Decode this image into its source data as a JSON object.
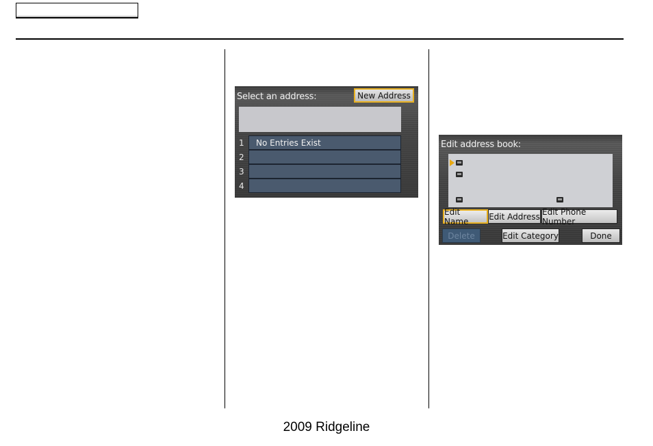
{
  "page": {
    "footer": "2009  Ridgeline"
  },
  "screen_select": {
    "title": "Select an address:",
    "new_button": "New Address",
    "rows": [
      {
        "num": "1",
        "label": "No Entries Exist"
      },
      {
        "num": "2",
        "label": ""
      },
      {
        "num": "3",
        "label": ""
      },
      {
        "num": "4",
        "label": ""
      }
    ]
  },
  "screen_edit": {
    "title": "Edit address book:",
    "icons": [
      "name-icon",
      "address-icon",
      "phone-icon",
      "category-icon"
    ],
    "tabs": [
      {
        "label": "Edit Name",
        "selected": true
      },
      {
        "label": "Edit Address",
        "selected": false
      },
      {
        "label": "Edit Phone Number",
        "selected": false
      }
    ],
    "buttons": {
      "delete": "Delete",
      "edit_category": "Edit Category",
      "done": "Done"
    }
  },
  "colors": {
    "highlight": "#e8b020",
    "row_fill": "#4a5a6e"
  }
}
